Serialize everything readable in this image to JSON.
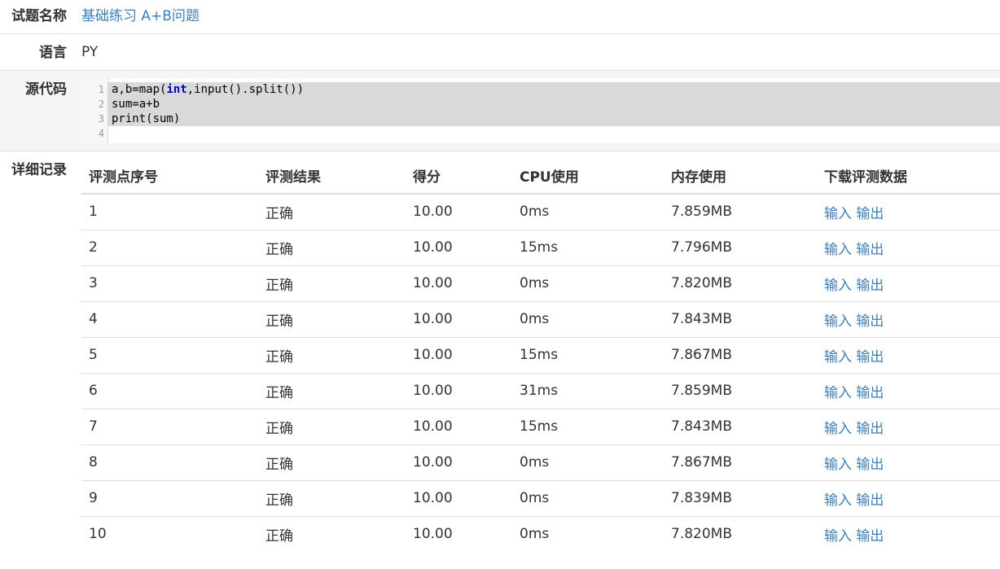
{
  "problem": {
    "label": "试题名称",
    "value": "基础练习 A+B问题"
  },
  "language": {
    "label": "语言",
    "value": "PY"
  },
  "source": {
    "label": "源代码",
    "line_numbers": [
      "1",
      "2",
      "3",
      "4"
    ],
    "lines": [
      {
        "pre": "a,b=map(",
        "kw": "int",
        "post": ",input().split())"
      },
      {
        "pre": "sum=a+b",
        "kw": "",
        "post": ""
      },
      {
        "pre": "print(sum)",
        "kw": "",
        "post": ""
      },
      {
        "pre": "",
        "kw": "",
        "post": ""
      }
    ]
  },
  "details": {
    "label": "详细记录",
    "headers": [
      "评测点序号",
      "评测结果",
      "得分",
      "CPU使用",
      "内存使用",
      "下载评测数据"
    ],
    "rows": [
      {
        "index": "1",
        "result": "正确",
        "score": "10.00",
        "cpu": "0ms",
        "mem": "7.859MB",
        "input": "输入",
        "output": "输出"
      },
      {
        "index": "2",
        "result": "正确",
        "score": "10.00",
        "cpu": "15ms",
        "mem": "7.796MB",
        "input": "输入",
        "output": "输出"
      },
      {
        "index": "3",
        "result": "正确",
        "score": "10.00",
        "cpu": "0ms",
        "mem": "7.820MB",
        "input": "输入",
        "output": "输出"
      },
      {
        "index": "4",
        "result": "正确",
        "score": "10.00",
        "cpu": "0ms",
        "mem": "7.843MB",
        "input": "输入",
        "output": "输出"
      },
      {
        "index": "5",
        "result": "正确",
        "score": "10.00",
        "cpu": "15ms",
        "mem": "7.867MB",
        "input": "输入",
        "output": "输出"
      },
      {
        "index": "6",
        "result": "正确",
        "score": "10.00",
        "cpu": "31ms",
        "mem": "7.859MB",
        "input": "输入",
        "output": "输出"
      },
      {
        "index": "7",
        "result": "正确",
        "score": "10.00",
        "cpu": "15ms",
        "mem": "7.843MB",
        "input": "输入",
        "output": "输出"
      },
      {
        "index": "8",
        "result": "正确",
        "score": "10.00",
        "cpu": "0ms",
        "mem": "7.867MB",
        "input": "输入",
        "output": "输出"
      },
      {
        "index": "9",
        "result": "正确",
        "score": "10.00",
        "cpu": "0ms",
        "mem": "7.839MB",
        "input": "输入",
        "output": "输出"
      },
      {
        "index": "10",
        "result": "正确",
        "score": "10.00",
        "cpu": "0ms",
        "mem": "7.820MB",
        "input": "输入",
        "output": "输出"
      }
    ]
  },
  "colors": {
    "link": "#3a80c0",
    "selection": "#d9d9d9",
    "keyword": "#0000cc"
  }
}
